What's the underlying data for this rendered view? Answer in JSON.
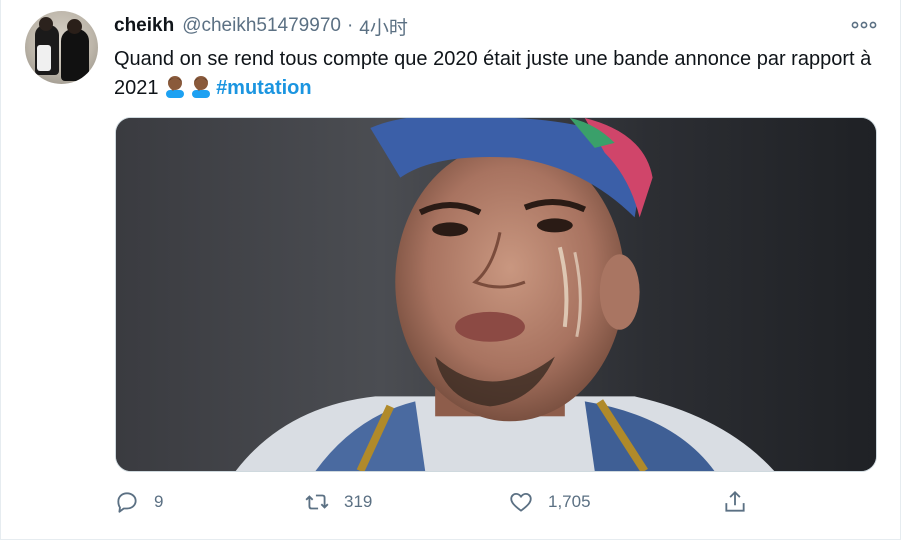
{
  "tweet": {
    "author_name": "cheikh",
    "author_handle": "@cheikh51479970",
    "separator": "·",
    "timestamp": "4小时",
    "text": "Quand on se rend tous compte que 2020 était juste une bande annonce par rapport à 2021",
    "emojis": [
      "man-facepalming-emoji",
      "man-facepalming-emoji"
    ],
    "hashtag": "#mutation"
  },
  "actions": {
    "reply_count": "9",
    "retweet_count": "319",
    "like_count": "1,705"
  },
  "colors": {
    "link": "#1b95e0",
    "secondary_text": "#5b7083",
    "primary_text": "#0f1419"
  }
}
